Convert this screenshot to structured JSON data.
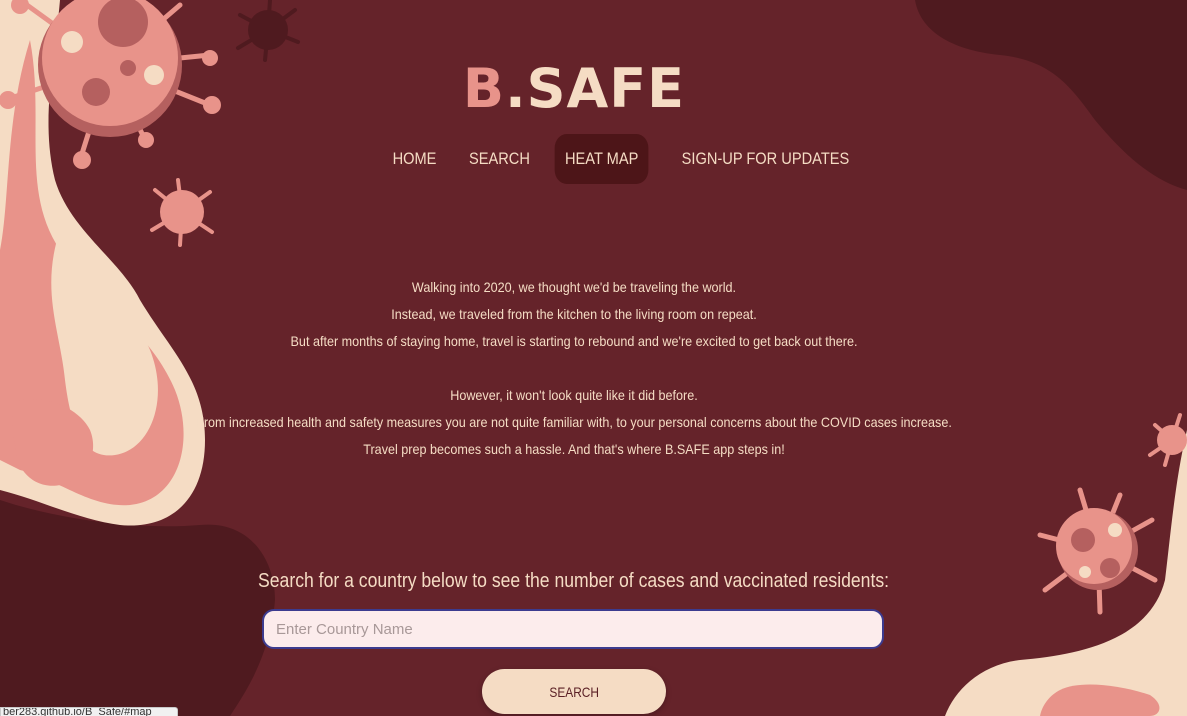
{
  "brand": {
    "first": "B",
    "rest": ".SAFE"
  },
  "nav": {
    "items": [
      {
        "label": "HOME"
      },
      {
        "label": "SEARCH"
      },
      {
        "label": "HEAT MAP",
        "active": true
      },
      {
        "label": "SIGN-UP FOR UPDATES"
      }
    ]
  },
  "intro": {
    "lines": [
      "Walking into 2020, we thought we'd be traveling the world.",
      "Instead, we traveled from the kitchen to the living room on repeat.",
      "But after months of staying home, travel is starting to rebound and we're excited to get back out there.",
      "However, it won't look quite like it did before.",
      "From increased health and safety measures you are not quite familiar with, to your personal concerns about the COVID cases increase.",
      "Travel prep becomes such a hassle. And that's where B.SAFE app steps in!"
    ]
  },
  "search": {
    "prompt": "Search for a country below to see the number of cases and vaccinated residents:",
    "placeholder": "Enter Country Name",
    "value": "",
    "button_label": "SEARCH"
  },
  "status_bar": {
    "url": "ber283.github.io/B_Safe/#map"
  },
  "colors": {
    "background": "#65232a",
    "dark_shape": "#4f1a1f",
    "cream": "#f5dcc4",
    "pink": "#e8938a",
    "nav_active": "#4d1518",
    "input_border": "#3c3b8f"
  }
}
